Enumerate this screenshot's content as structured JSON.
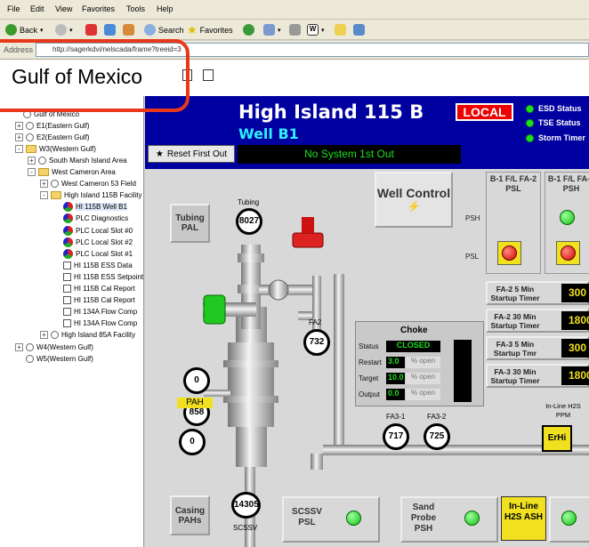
{
  "browser": {
    "menu": [
      "File",
      "Edit",
      "View",
      "Favorites",
      "Tools",
      "Help"
    ],
    "toolbar": {
      "back": "Back",
      "search": "Search",
      "favorites": "Favorites"
    },
    "address_label": "Address",
    "url": "http://sagerkdvi/nelscada/frame?treeid=3"
  },
  "page": {
    "title": "Gulf of Mexico"
  },
  "tree": [
    {
      "label": "Gulf of Mexico",
      "level": 0,
      "kind": "root"
    },
    {
      "label": "E1(Eastern Gulf)",
      "level": 1,
      "kind": "circle",
      "pm": "+"
    },
    {
      "label": "E2(Eastern Gulf)",
      "level": 1,
      "kind": "circle",
      "pm": "+"
    },
    {
      "label": "W3(Western Gulf)",
      "level": 1,
      "kind": "folder",
      "pm": "-"
    },
    {
      "label": "South Marsh Island Area",
      "level": 2,
      "kind": "circle",
      "pm": "+"
    },
    {
      "label": "West Cameron Area",
      "level": 2,
      "kind": "folder",
      "pm": "-"
    },
    {
      "label": "West Cameron 53 Field",
      "level": 3,
      "kind": "circle",
      "pm": "+"
    },
    {
      "label": "High Island 115B Facility",
      "level": 3,
      "kind": "folder",
      "pm": "-"
    },
    {
      "label": "HI 115B Well B1",
      "level": 4,
      "kind": "gear",
      "selected": true
    },
    {
      "label": "PLC Diagnostics",
      "level": 4,
      "kind": "gear"
    },
    {
      "label": "PLC Local Slot #0",
      "level": 4,
      "kind": "gear"
    },
    {
      "label": "PLC Local Slot #2",
      "level": 4,
      "kind": "gear"
    },
    {
      "label": "PLC Local Slot #1",
      "level": 4,
      "kind": "gear"
    },
    {
      "label": "HI 115B ESS Data",
      "level": 4,
      "kind": "check"
    },
    {
      "label": "HI 115B ESS Setpoints",
      "level": 4,
      "kind": "check"
    },
    {
      "label": "HI 115B Cal Report",
      "level": 4,
      "kind": "check"
    },
    {
      "label": "HI 115B Cal Report",
      "level": 4,
      "kind": "check"
    },
    {
      "label": "HI 134A Flow Comp",
      "level": 4,
      "kind": "check"
    },
    {
      "label": "HI 134A Flow Comp",
      "level": 4,
      "kind": "check"
    },
    {
      "label": "High Island 85A Facility",
      "level": 3,
      "kind": "circle",
      "pm": "+"
    },
    {
      "label": "W4(Western Gulf)",
      "level": 1,
      "kind": "circle",
      "pm": "+"
    },
    {
      "label": "W5(Western Gulf)",
      "level": 1,
      "kind": "circle",
      "pm": ""
    }
  ],
  "hmi": {
    "site": "High Island 115 B",
    "well": "Well B1",
    "mode": "LOCAL",
    "status": [
      "ESD Status",
      "TSE Status",
      "Storm Timer"
    ],
    "reset_label": "Reset First Out",
    "first_out": "No System 1st Out",
    "well_control": "Well Control",
    "tubing_pal": "Tubing PAL",
    "casing_pals": "Casing PAHs",
    "scssv_psl": "SCSSV PSL",
    "sand_probe": "Sand Probe PSH",
    "inline_ash": "In-Line H2S ASH",
    "gauges": {
      "tubing": {
        "label": "Tubing",
        "value": "8027"
      },
      "fa2": {
        "label": "FA2",
        "value": "732"
      },
      "casing1": {
        "value": "0"
      },
      "casing2": {
        "value": "858"
      },
      "casing3": {
        "value": "0"
      },
      "scssv": {
        "label": "SCSSV",
        "value": "14305"
      },
      "fa31": {
        "label": "FA3-1",
        "value": "717"
      },
      "fa32": {
        "label": "FA3-2",
        "value": "725"
      }
    },
    "pah_label": "PAH",
    "fl_panels": [
      {
        "title": "B-1 F/L FA-2 PSL",
        "psh": "PSH",
        "psl": "PSL"
      },
      {
        "title": "B-1 F/L FA-3 PSH"
      }
    ],
    "timers": [
      {
        "label": "FA-2   5 Min Startup Timer",
        "value": "300"
      },
      {
        "label": "FA-2   30 Min Startup Timer",
        "value": "1800"
      },
      {
        "label": "FA-3   5 Min Startup Tmr",
        "value": "300"
      },
      {
        "label": "FA-3   30 Min Startup Timer",
        "value": "1800"
      }
    ],
    "choke": {
      "title": "Choke",
      "status_label": "Status",
      "status": "CLOSED",
      "restart_label": "Restart",
      "restart": "3.0",
      "target_label": "Target",
      "target": "10.0",
      "output_label": "Output",
      "output": "0.0",
      "pct": "% open"
    },
    "h2s": {
      "label": "In-Line H2S PPM",
      "value": "ErHi"
    }
  },
  "colors": {
    "hmi_header": "#0000a0",
    "led_green": "#1ee01e",
    "alarm_red": "#d40000",
    "annotation": "#e8381a"
  }
}
